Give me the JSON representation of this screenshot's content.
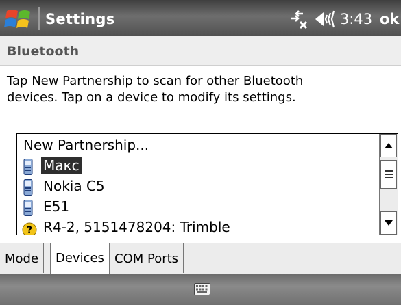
{
  "title_bar": {
    "title": "Settings",
    "time": "3:43",
    "ok_label": "ok",
    "icons": [
      "windows-start-icon",
      "connectivity-icon",
      "volume-icon"
    ]
  },
  "header": {
    "title": "Bluetooth"
  },
  "instructions": "Tap New Partnership to scan for other Bluetooth devices. Tap on a device to modify its settings.",
  "device_list": {
    "items": [
      {
        "label": "New Partnership...",
        "icon": "none",
        "selected": false
      },
      {
        "label": "Макс",
        "icon": "phone-icon",
        "selected": true
      },
      {
        "label": "Nokia C5",
        "icon": "phone-icon",
        "selected": false
      },
      {
        "label": "E51",
        "icon": "phone-icon",
        "selected": false
      },
      {
        "label": "R4-2, 5151478204: Trimble",
        "icon": "question-icon",
        "selected": false
      }
    ]
  },
  "tabs": [
    {
      "label": "Mode",
      "active": false
    },
    {
      "label": "Devices",
      "active": true
    },
    {
      "label": "COM Ports",
      "active": false
    }
  ],
  "bottom_bar": {
    "icons": [
      "keyboard-icon"
    ]
  },
  "colors": {
    "selection_bg": "#2e2e2e",
    "header_bg": "#eeeeee",
    "title_bar_bg": "#5a5a5a"
  }
}
